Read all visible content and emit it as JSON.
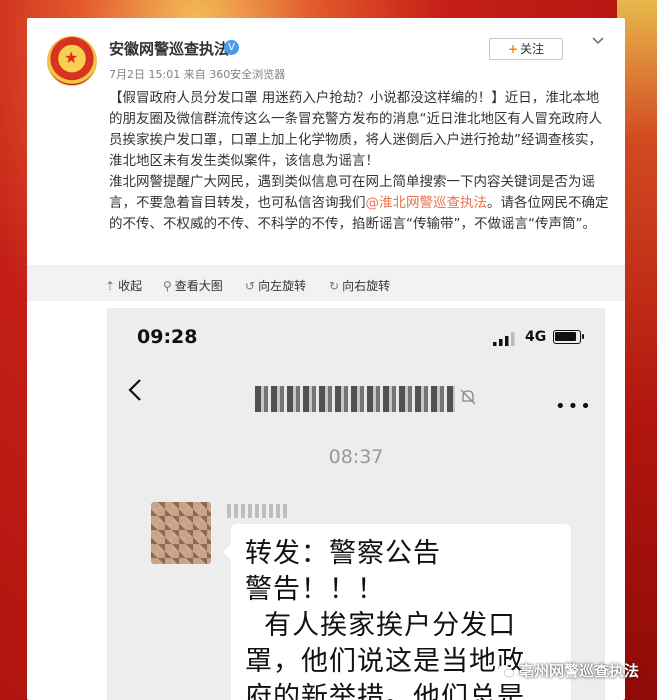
{
  "account": {
    "name": "安徽网警巡查执法",
    "verified_icon": "verified-v-icon",
    "date": "7月2日 15:01",
    "source": "来自 360安全浏览器"
  },
  "follow_button": {
    "label": "关注"
  },
  "post": {
    "paragraph1": "【假冒政府人员分发口罩 用迷药入户抢劫？小说都没这样编的！】近日，淮北本地的朋友圈及微信群流传这么一条冒充警方发布的消息“近日淮北地区有人冒充政府人员挨家挨户发口罩，口罩上加上化学物质，将人迷倒后入户进行抢劫”经调查核实，淮北地区未有发生类似案件，该信息为谣言！",
    "paragraph2_before": "淮北网警提醒广大网民，遇到类似信息可在网上简单搜索一下内容关键词是否为谣言，不要急着盲目转发，也可私信咨询我们",
    "mention": "@淮北网警巡查执法",
    "paragraph2_after": "。请各位网民不确定的不传、不权威的不传、不科学的不传，掐断谣言“传输带”，不做谣言“传声筒”。"
  },
  "toolbar": {
    "collapse": "收起",
    "view_large": "查看大图",
    "rotate_left": "向左旋转",
    "rotate_right": "向右旋转"
  },
  "phone": {
    "status_time": "09:28",
    "network": "4G",
    "message_time": "08:37",
    "message_lines": [
      "转发：警察公告",
      "警告！！！",
      "  有人挨家挨户分发口",
      "罩，他们说这是当地政",
      "府的新举措。他们总是"
    ]
  },
  "watermark": {
    "text": "亳州网警巡查执法"
  }
}
